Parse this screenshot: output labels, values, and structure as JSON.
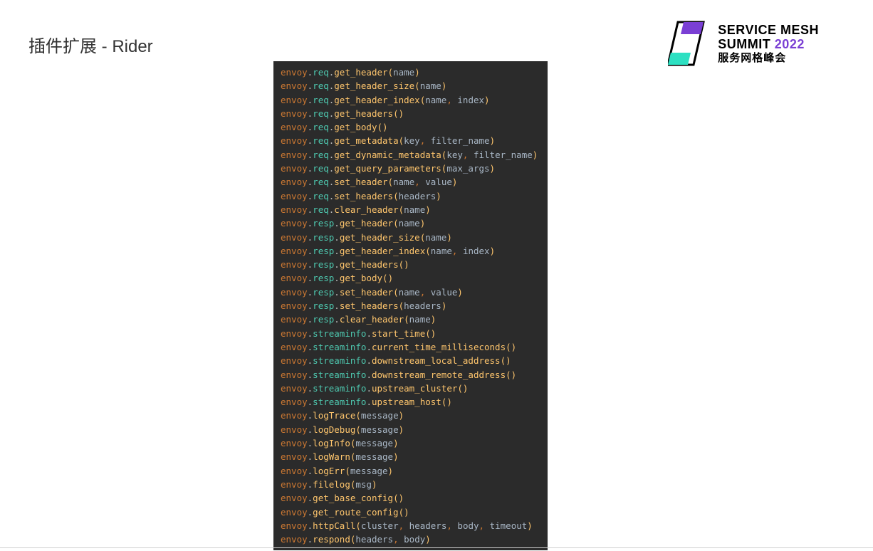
{
  "title": "插件扩展 - Rider",
  "logo": {
    "line1": "SERVICE MESH",
    "line2a": "SUMMIT ",
    "line2b": "2022",
    "line3": "服务网格峰会"
  },
  "code": [
    {
      "mod": "req",
      "fn": "get_header",
      "args": [
        "name"
      ]
    },
    {
      "mod": "req",
      "fn": "get_header_size",
      "args": [
        "name"
      ]
    },
    {
      "mod": "req",
      "fn": "get_header_index",
      "args": [
        "name",
        "index"
      ]
    },
    {
      "mod": "req",
      "fn": "get_headers",
      "args": []
    },
    {
      "mod": "req",
      "fn": "get_body",
      "args": []
    },
    {
      "mod": "req",
      "fn": "get_metadata",
      "args": [
        "key",
        "filter_name"
      ]
    },
    {
      "mod": "req",
      "fn": "get_dynamic_metadata",
      "args": [
        "key",
        "filter_name"
      ]
    },
    {
      "mod": "req",
      "fn": "get_query_parameters",
      "args": [
        "max_args"
      ]
    },
    {
      "mod": "req",
      "fn": "set_header",
      "args": [
        "name",
        "value"
      ]
    },
    {
      "mod": "req",
      "fn": "set_headers",
      "args": [
        "headers"
      ]
    },
    {
      "mod": "req",
      "fn": "clear_header",
      "args": [
        "name"
      ]
    },
    {
      "mod": "resp",
      "fn": "get_header",
      "args": [
        "name"
      ]
    },
    {
      "mod": "resp",
      "fn": "get_header_size",
      "args": [
        "name"
      ]
    },
    {
      "mod": "resp",
      "fn": "get_header_index",
      "args": [
        "name",
        "index"
      ]
    },
    {
      "mod": "resp",
      "fn": "get_headers",
      "args": []
    },
    {
      "mod": "resp",
      "fn": "get_body",
      "args": []
    },
    {
      "mod": "resp",
      "fn": "set_header",
      "args": [
        "name",
        "value"
      ]
    },
    {
      "mod": "resp",
      "fn": "set_headers",
      "args": [
        "headers"
      ]
    },
    {
      "mod": "resp",
      "fn": "clear_header",
      "args": [
        "name"
      ]
    },
    {
      "mod": "streaminfo",
      "fn": "start_time",
      "args": []
    },
    {
      "mod": "streaminfo",
      "fn": "current_time_milliseconds",
      "args": []
    },
    {
      "mod": "streaminfo",
      "fn": "downstream_local_address",
      "args": []
    },
    {
      "mod": "streaminfo",
      "fn": "downstream_remote_address",
      "args": []
    },
    {
      "mod": "streaminfo",
      "fn": "upstream_cluster",
      "args": []
    },
    {
      "mod": "streaminfo",
      "fn": "upstream_host",
      "args": []
    },
    {
      "mod": null,
      "fn": "logTrace",
      "args": [
        "message"
      ]
    },
    {
      "mod": null,
      "fn": "logDebug",
      "args": [
        "message"
      ]
    },
    {
      "mod": null,
      "fn": "logInfo",
      "args": [
        "message"
      ]
    },
    {
      "mod": null,
      "fn": "logWarn",
      "args": [
        "message"
      ]
    },
    {
      "mod": null,
      "fn": "logErr",
      "args": [
        "message"
      ]
    },
    {
      "mod": null,
      "fn": "filelog",
      "args": [
        "msg"
      ]
    },
    {
      "mod": null,
      "fn": "get_base_config",
      "args": []
    },
    {
      "mod": null,
      "fn": "get_route_config",
      "args": []
    },
    {
      "mod": null,
      "fn": "httpCall",
      "args": [
        "cluster",
        "headers",
        "body",
        "timeout"
      ]
    },
    {
      "mod": null,
      "fn": "respond",
      "args": [
        "headers",
        "body"
      ]
    }
  ]
}
